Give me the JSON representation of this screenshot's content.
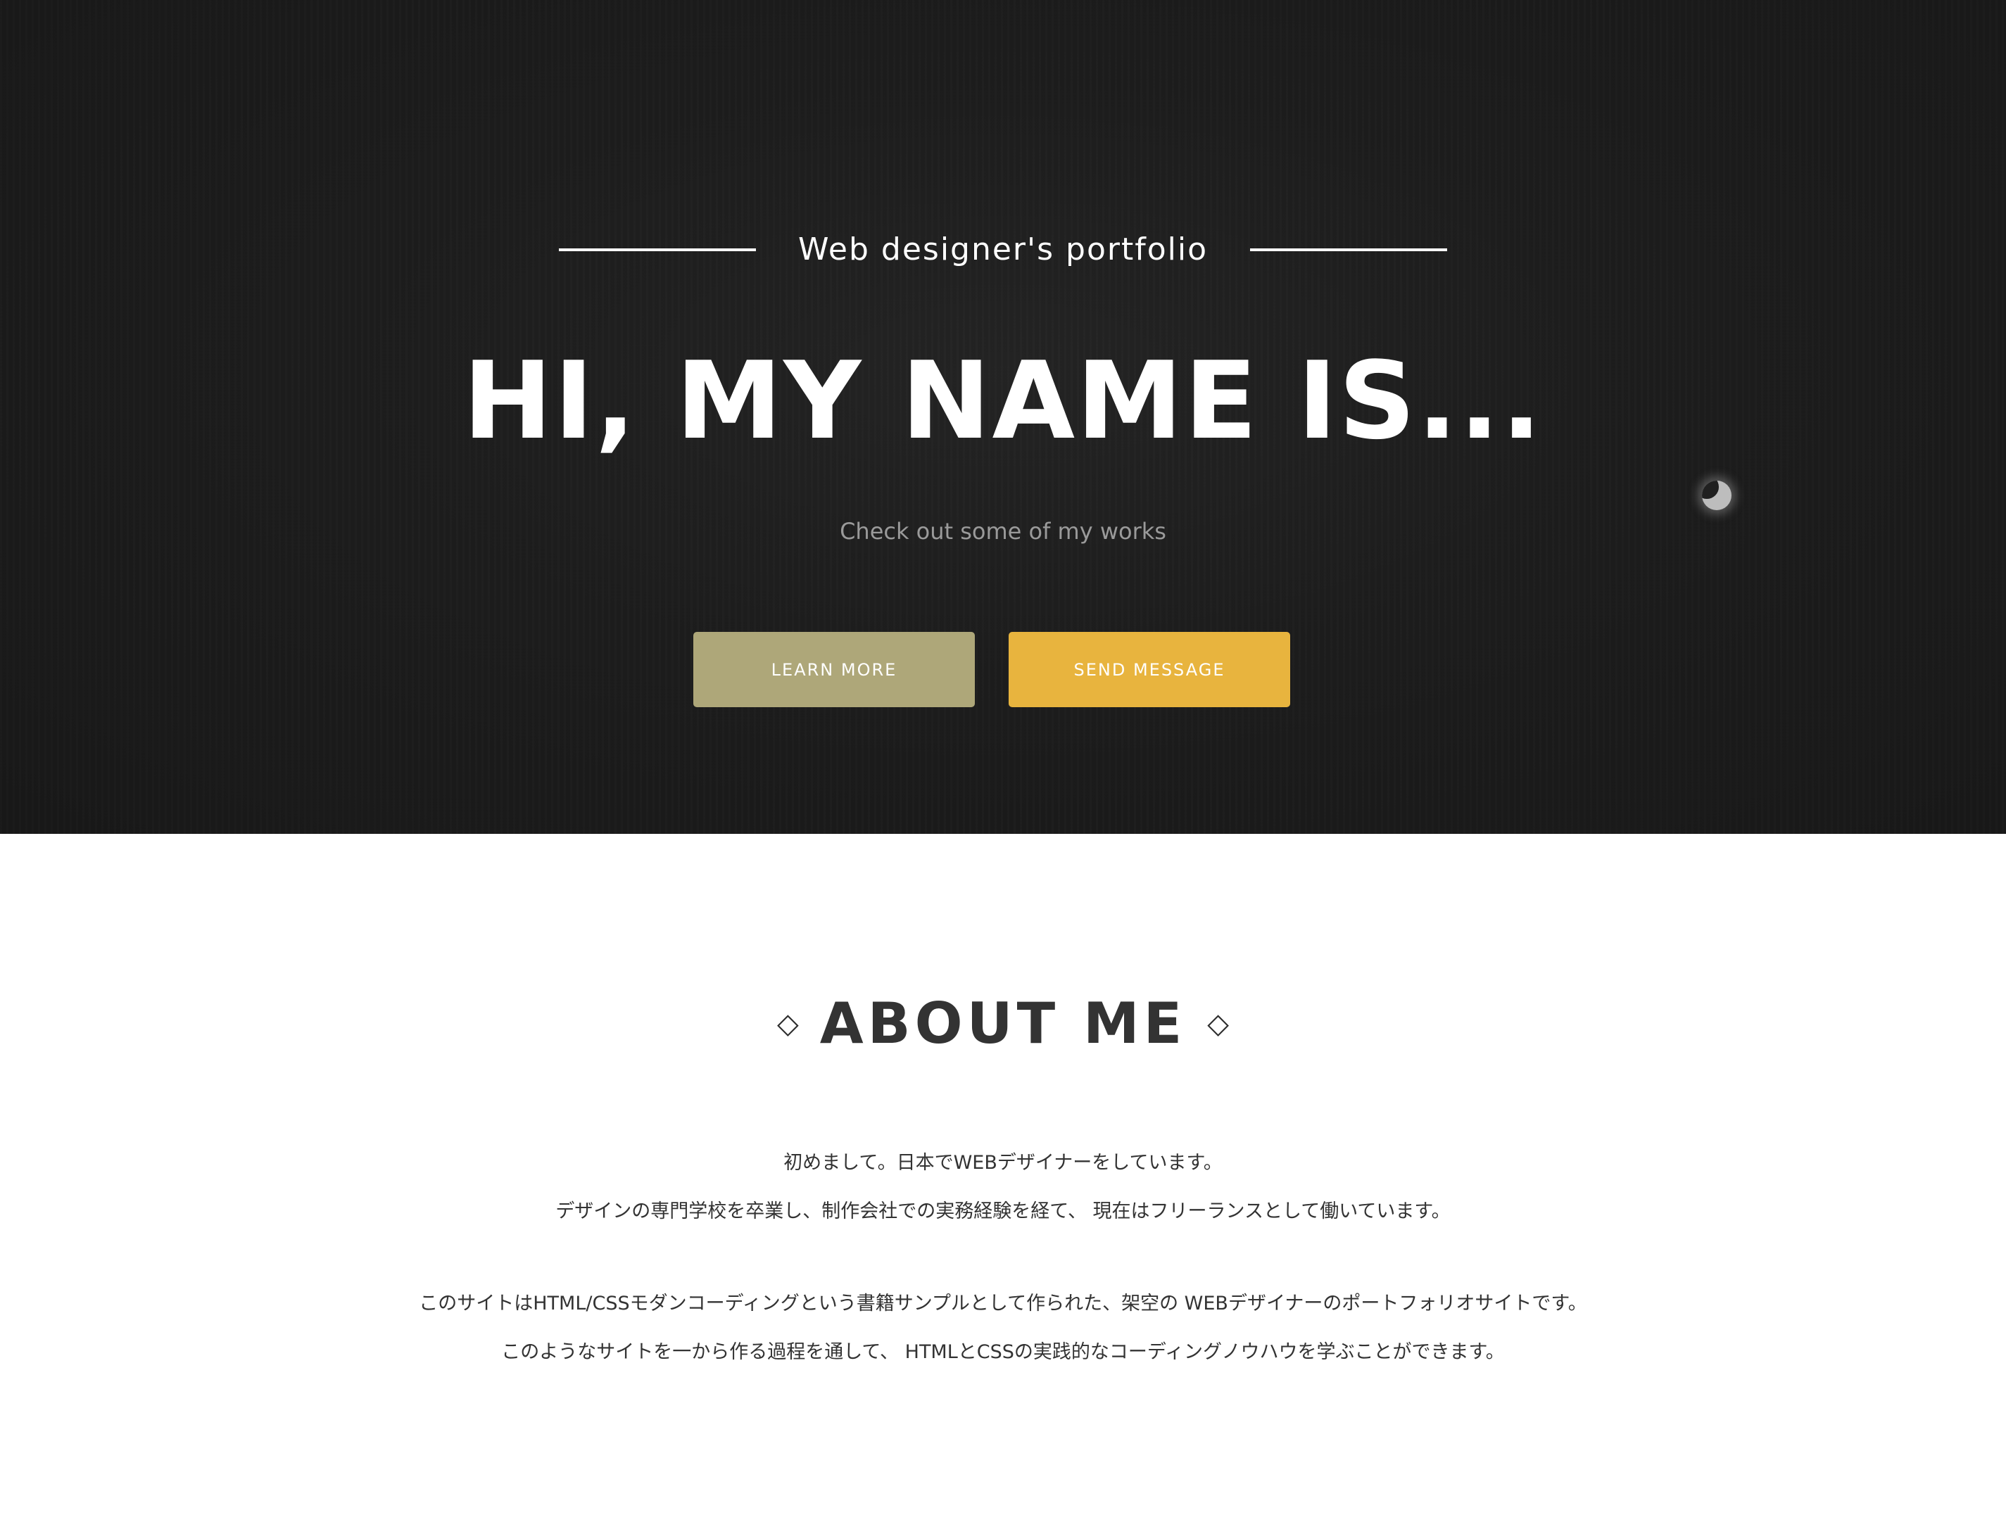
{
  "hero": {
    "tagline": "Web designer's portfolio",
    "title": "HI, MY NAME IS...",
    "subtitle": "Check out some of my works",
    "buttons": {
      "learn_more": "LEARN MORE",
      "send_message": "SEND MESSAGE"
    },
    "colors": {
      "background": "#1d1d1d",
      "learn_more_button": "#aea779",
      "send_message_button": "#e8b43e"
    }
  },
  "about": {
    "heading": "ABOUT ME",
    "diamond_glyph": "◇",
    "paragraphs": [
      "初めまして。日本でWEBデザイナーをしています。",
      "デザインの専門学校を卒業し、制作会社での実務経験を経て、 現在はフリーランスとして働いています。",
      "このサイトはHTML/CSSモダンコーディングという書籍サンプルとして作られた、架空の WEBデザイナーのポートフォリオサイトです。",
      "このようなサイトを一から作る過程を通して、 HTMLとCSSの実践的なコーディングノウハウを学ぶことができます。"
    ]
  }
}
